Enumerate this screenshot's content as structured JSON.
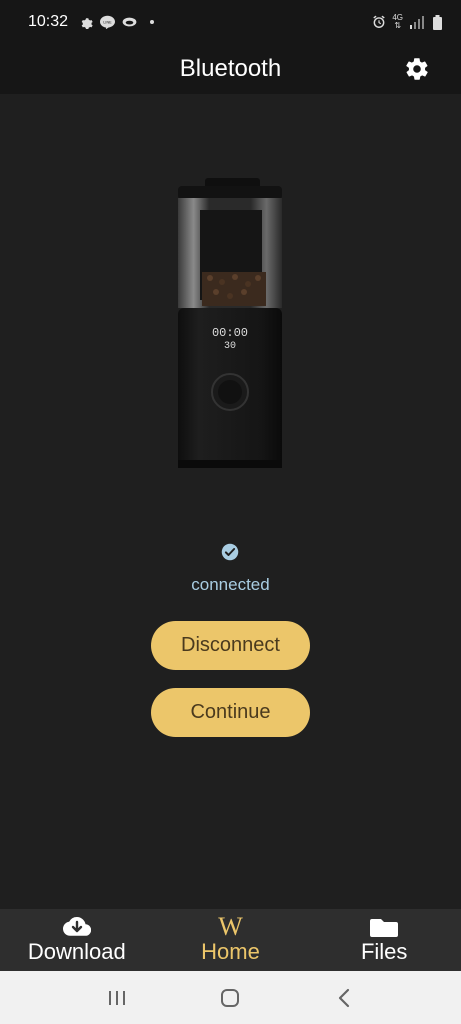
{
  "status_bar": {
    "time": "10:32",
    "network": "4G",
    "icons": [
      "gear-icon",
      "line-icon",
      "cloud-icon",
      "alarm-icon",
      "signal-icon",
      "battery-icon"
    ]
  },
  "header": {
    "title": "Bluetooth",
    "settings_icon": "gear-icon"
  },
  "device": {
    "display_time": "00:00",
    "display_temp": "30"
  },
  "connection": {
    "status": "connected",
    "icon": "check-circle-icon"
  },
  "actions": {
    "disconnect_label": "Disconnect",
    "continue_label": "Continue"
  },
  "tabs": [
    {
      "label": "Download",
      "icon": "cloud-download-icon",
      "active": false
    },
    {
      "label": "Home",
      "icon": "w-logo-icon",
      "active": true
    },
    {
      "label": "Files",
      "icon": "folder-icon",
      "active": false
    }
  ],
  "colors": {
    "background": "#1f1f1f",
    "accent": "#ecc66a",
    "button_text": "#4a3a1e",
    "status_text": "#a9cde2",
    "tab_bar": "#2e2e2e"
  }
}
